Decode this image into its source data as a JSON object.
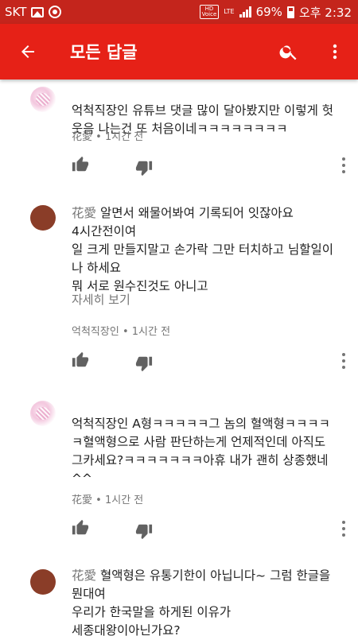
{
  "status_bar": {
    "carrier": "SKT",
    "hd_label": "HD",
    "voice_label": "Voice",
    "lte_label": "LTE",
    "battery": "69%",
    "time": "오후 2:32"
  },
  "app_bar": {
    "title": "모든 답글",
    "icons": [
      "back-arrow-icon",
      "search-icon",
      "more-vert-icon"
    ]
  },
  "comments": [
    {
      "avatar": "flower",
      "author_inline": "",
      "text": "억척직장인 유튜브 댓글 많이 달아봤지만 이렇게 헛웃음 나는건 또 처음이네ㅋㅋㅋㅋㅋㅋㅋㅋ",
      "more": "",
      "author": "花愛",
      "time": "1시간 전"
    },
    {
      "avatar": "brown",
      "author_inline": "花愛",
      "text": " 알면서 왜물어봐여 기록되어 잇잖아요\n4시간전이여\n일 크게 만들지말고 손가락 그만 터치하고 님할일이나 하세요\n뭐 서로 원수진것도 아니고",
      "more": "자세히 보기",
      "author": "억척직장인",
      "time": "1시간 전"
    },
    {
      "avatar": "flower",
      "author_inline": "",
      "text": "억척직장인 A형ㅋㅋㅋㅋㅋ그 놈의 혈액형ㅋㅋㅋㅋㅋ혈액형으로 사람 판단하는게 언제적인데 아직도\n그카세요?ㅋㅋㅋㅋㅋㅋㅋ아휴 내가 괜히 상종했네^^",
      "more": "",
      "author": "花愛",
      "time": "1시간 전"
    },
    {
      "avatar": "brown",
      "author_inline": "花愛",
      "text": " 혈액형은 유통기한이 아닙니다~ 그럼 한글을뭔대여\n우리가 한국말을 하게된 이유가\n세종대왕이아닌가요?",
      "more": "",
      "author": "",
      "time": ""
    }
  ],
  "meta_separator": "•",
  "colors": {
    "status_bar": "#c4251c",
    "app_bar": "#e62117",
    "secondary_text": "#757575",
    "icon": "#616161"
  }
}
